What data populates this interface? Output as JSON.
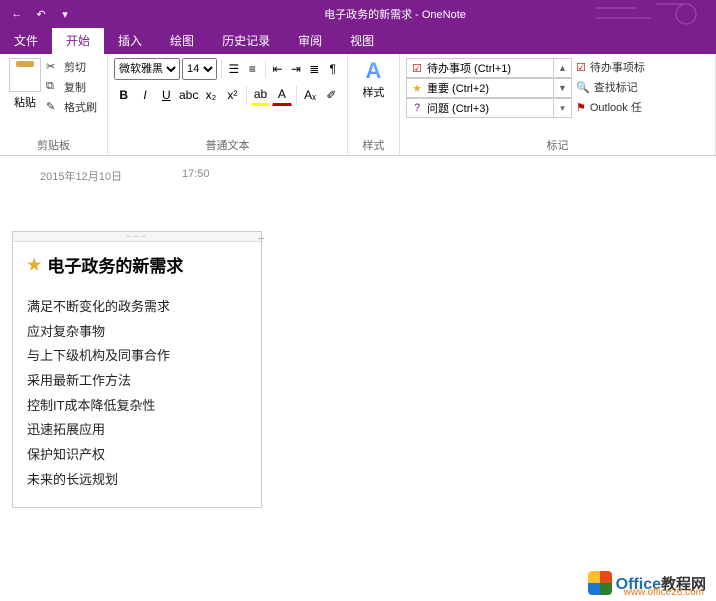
{
  "window": {
    "title": "电子政务的新需求 - OneNote"
  },
  "tabs": {
    "file": "文件",
    "home": "开始",
    "insert": "插入",
    "draw": "绘图",
    "history": "历史记录",
    "review": "审阅",
    "view": "视图"
  },
  "ribbon": {
    "clipboard": {
      "paste": "粘贴",
      "cut": "剪切",
      "copy": "复制",
      "fmtpaint": "格式刷",
      "label": "剪贴板"
    },
    "font": {
      "name": "微软雅黑",
      "size": "14",
      "label": "普通文本"
    },
    "styles": {
      "btn": "样式",
      "label": "样式"
    },
    "tags": {
      "todo": "待办事项 (Ctrl+1)",
      "important": "重要 (Ctrl+2)",
      "question": "问题 (Ctrl+3)",
      "todo2": "待办事项标",
      "find": "查找标记",
      "outlook": "Outlook 任",
      "label": "标记"
    }
  },
  "page": {
    "date": "2015年12月10日",
    "time": "17:50",
    "title": "电子政务的新需求",
    "lines": [
      "满足不断变化的政务需求",
      "应对复杂事物",
      "与上下级机构及同事合作",
      "采用最新工作方法",
      "控制IT成本降低复杂性",
      "迅速拓展应用",
      "保护知识产权",
      "未来的长远规划"
    ]
  },
  "watermark": {
    "brand1": "Office",
    "brand2": "教程网",
    "url": "www.office26.com"
  }
}
